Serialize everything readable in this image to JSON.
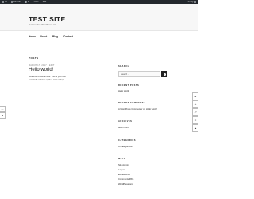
{
  "admin_bar": {
    "items": [
      "W",
      "Site title",
      "0",
      "+ New",
      "Edit"
    ],
    "right": "Howdy"
  },
  "header": {
    "site_title": "TEST SITE",
    "tagline": "Just another WordPress site"
  },
  "nav": {
    "items": [
      "Home",
      "About",
      "Blog",
      "Contact"
    ]
  },
  "main": {
    "page_title": "POSTS",
    "post": {
      "meta": "MARCH 17, 2017 · EDIT",
      "title": "Hello world!",
      "excerpt": "Welcome to WordPress. This is your first post. Edit or delete it, then start writing!"
    }
  },
  "sidebar": {
    "search_title": "SEARCH",
    "search_placeholder": "Search ...",
    "recent_posts_title": "RECENT POSTS",
    "recent_posts": [
      "Hello world!"
    ],
    "recent_comments_title": "RECENT COMMENTS",
    "recent_comments": [
      "A WordPress Commenter on Hello world!"
    ],
    "archives_title": "ARCHIVES",
    "archives": [
      "March 2017"
    ],
    "categories_title": "CATEGORIES",
    "categories": [
      "Uncategorized"
    ],
    "meta_title": "META",
    "meta": [
      "Site Admin",
      "Log out",
      "Entries RSS",
      "Comments RSS",
      "WordPress.org"
    ]
  },
  "controls": {
    "left_tab_icons": [
      "ellipsis-icon",
      "caret-left-icon"
    ],
    "right_rail_icons": [
      "caret-right-icon",
      "plus-icon",
      "arrow-icon",
      "x-icon",
      "caret-up-icon"
    ]
  },
  "colors": {
    "admin_bar": "#23282d",
    "header_bg": "#f7f7f7",
    "button_dark": "#222222"
  }
}
